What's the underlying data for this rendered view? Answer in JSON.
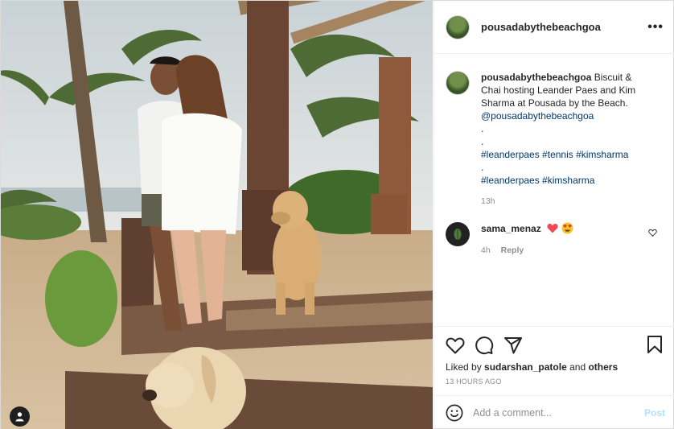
{
  "post": {
    "username": "pousadabythebeachgoa",
    "more_icon": "more-horizontal-icon",
    "caption": {
      "username": "pousadabythebeachgoa",
      "text_line1": "Biscuit &",
      "text_line2": "Chai hosting Leander Paes and Kim",
      "text_line3": "Sharma at Pousada by the Beach.",
      "mention": "@pousadabythebeachgoa",
      "dot1": ".",
      "dot2": ".",
      "hashtags1": "#leanderpaes #tennis #kimsharma",
      "dot3": ".",
      "hashtags2": "#leanderpaes #kimsharma",
      "time": "13h"
    },
    "comments": [
      {
        "username": "sama_menaz",
        "emojis": "❤️😍",
        "time": "4h",
        "reply_label": "Reply"
      }
    ],
    "likes": {
      "prefix": "Liked by",
      "user": "sudarshan_patole",
      "and": "and",
      "others": "others"
    },
    "date": "13 HOURS AGO",
    "add_comment": {
      "placeholder": "Add a comment...",
      "post_label": "Post"
    },
    "colors": {
      "link": "#00376b",
      "muted": "#8e8e8e",
      "post_disabled": "#b2dffc",
      "heart_red": "#ed4956"
    }
  }
}
